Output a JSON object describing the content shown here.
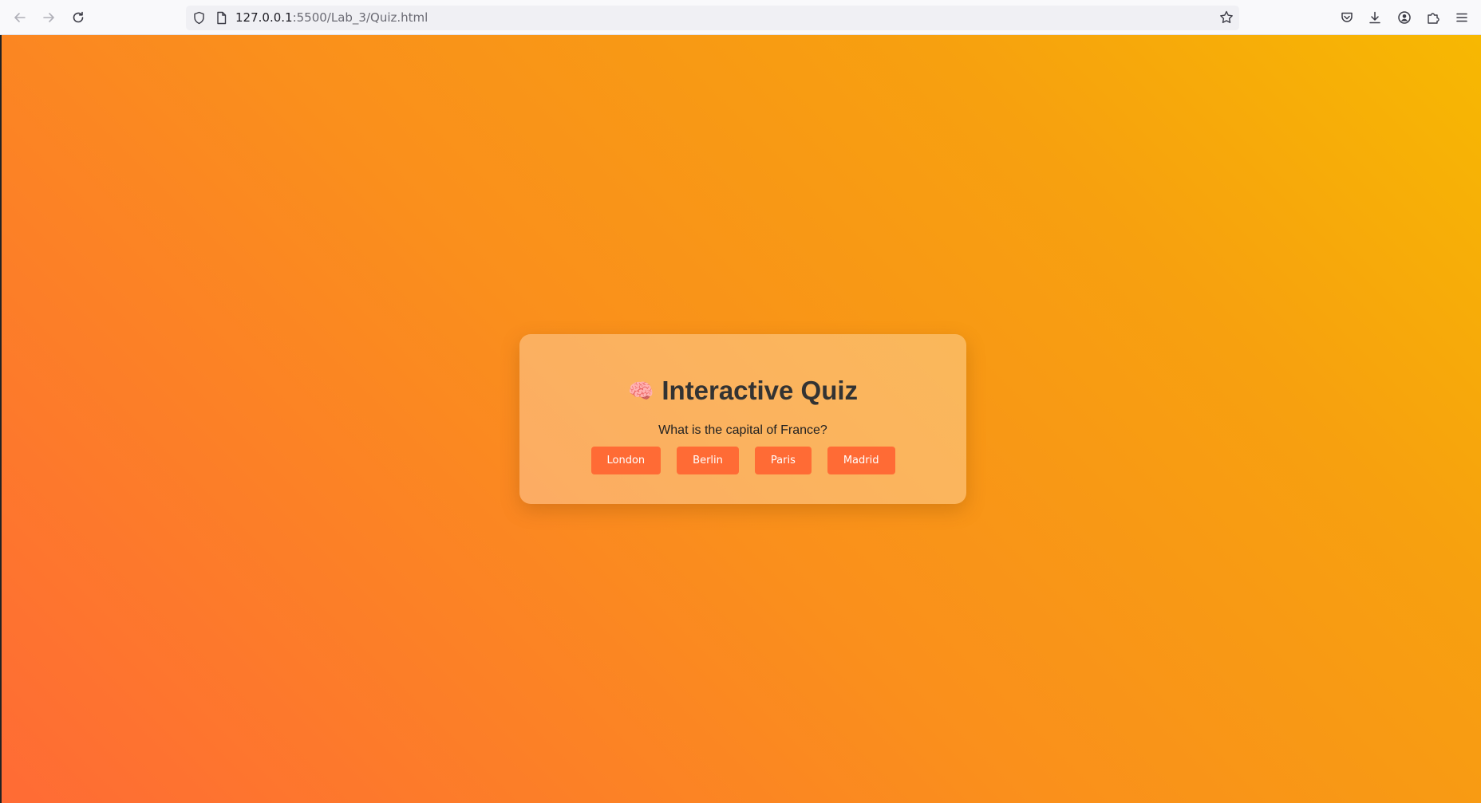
{
  "browser": {
    "url_host": "127.0.0.1",
    "url_path": ":5500/Lab_3/Quiz.html"
  },
  "icons": {
    "back": "back-arrow-icon",
    "forward": "forward-arrow-icon",
    "reload": "reload-icon",
    "shield": "tracking-protection-shield-icon",
    "page": "page-info-icon",
    "bookmark": "bookmark-star-icon",
    "pocket": "pocket-icon",
    "downloads": "download-icon",
    "account": "account-icon",
    "extensions": "extensions-icon",
    "menu": "hamburger-menu-icon",
    "brain": "brain-icon"
  },
  "quiz": {
    "brain_emoji": "🧠",
    "title": "Interactive Quiz",
    "question": "What is the capital of France?",
    "options": [
      "London",
      "Berlin",
      "Paris",
      "Madrid"
    ]
  },
  "colors": {
    "gradient_start": "#ff6b35",
    "gradient_end": "#f7b802",
    "button": "#ff6b35",
    "title_text": "#333333"
  }
}
